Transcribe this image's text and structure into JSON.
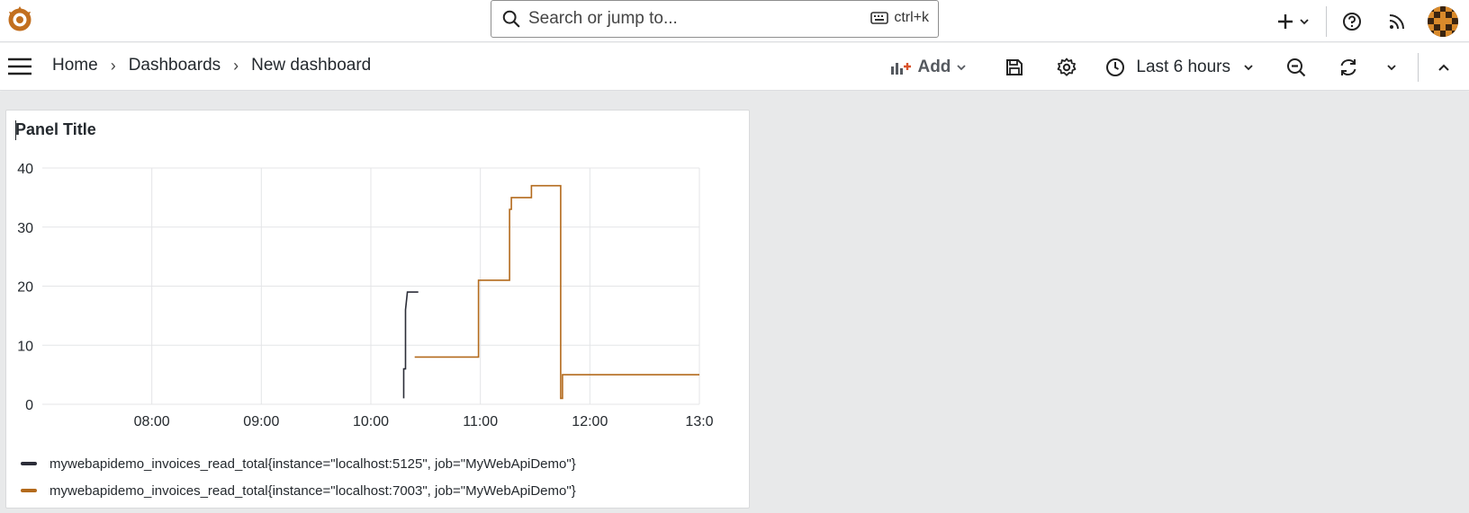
{
  "search": {
    "placeholder": "Search or jump to...",
    "shortcut": "ctrl+k"
  },
  "breadcrumb": {
    "items": [
      "Home",
      "Dashboards",
      "New dashboard"
    ]
  },
  "toolbar": {
    "add_label": "Add",
    "time_range": "Last 6 hours"
  },
  "panel": {
    "title": "Panel Title"
  },
  "colors": {
    "series1": "#2b2d38",
    "series2": "#b36a1c",
    "grid": "#e4e5e7"
  },
  "chart_data": {
    "type": "line",
    "title": "Panel Title",
    "xlabel": "",
    "ylabel": "",
    "x_ticks": [
      "08:00",
      "09:00",
      "10:00",
      "11:00",
      "12:00",
      "13:0"
    ],
    "y_ticks": [
      "0",
      "10",
      "20",
      "30",
      "40"
    ],
    "xlim": [
      "07:00",
      "13:00"
    ],
    "ylim": [
      0,
      40
    ],
    "grid": true,
    "legend_position": "bottom",
    "series": [
      {
        "name": "mywebapidemo_invoices_read_total{instance=\"localhost:5125\", job=\"MyWebApiDemo\"}",
        "color": "#2b2d38",
        "points": [
          [
            "10:18",
            1
          ],
          [
            "10:18",
            6
          ],
          [
            "10:19",
            6
          ],
          [
            "10:19",
            16
          ],
          [
            "10:20",
            19
          ],
          [
            "10:26",
            19
          ]
        ]
      },
      {
        "name": "mywebapidemo_invoices_read_total{instance=\"localhost:7003\", job=\"MyWebApiDemo\"}",
        "color": "#b36a1c",
        "points": [
          [
            "10:24",
            8
          ],
          [
            "10:59",
            8
          ],
          [
            "10:59",
            21
          ],
          [
            "11:16",
            21
          ],
          [
            "11:16",
            33
          ],
          [
            "11:17",
            33
          ],
          [
            "11:17",
            35
          ],
          [
            "11:28",
            35
          ],
          [
            "11:28",
            37
          ],
          [
            "11:44",
            37
          ],
          [
            "11:44",
            1
          ],
          [
            "11:45",
            1
          ],
          [
            "11:45",
            5
          ],
          [
            "13:00",
            5
          ]
        ]
      }
    ]
  }
}
